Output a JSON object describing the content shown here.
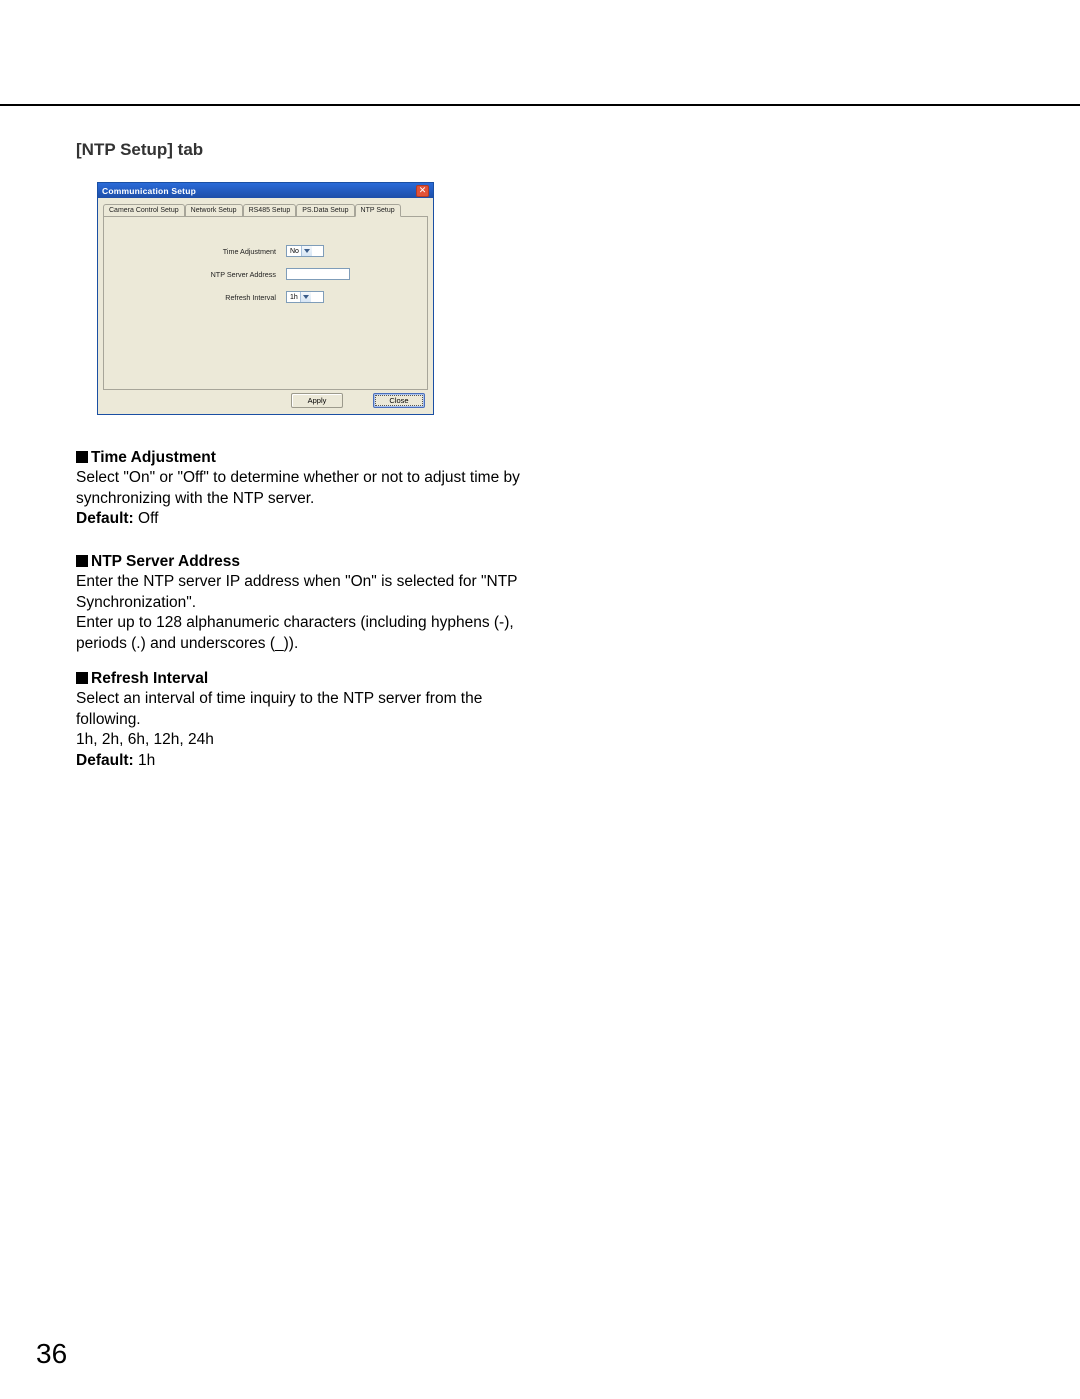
{
  "page": {
    "number": "36",
    "section_title": "[NTP Setup] tab"
  },
  "dialog": {
    "title": "Communication Setup",
    "close_glyph": "✕",
    "tabs": {
      "camera_control": "Camera Control Setup",
      "network": "Network Setup",
      "rs485": "RS485 Setup",
      "psdata": "PS.Data Setup",
      "ntp": "NTP Setup"
    },
    "fields": {
      "time_adjustment": {
        "label": "Time Adjustment",
        "value": "No"
      },
      "ntp_server_address": {
        "label": "NTP Server Address",
        "value": ""
      },
      "refresh_interval": {
        "label": "Refresh Interval",
        "value": "1h"
      }
    },
    "buttons": {
      "apply": "Apply",
      "close": "Close"
    }
  },
  "sections": {
    "time_adjustment": {
      "heading": "Time Adjustment",
      "body": "Select \"On\" or \"Off\" to determine whether or not to adjust time by synchronizing with the NTP server.",
      "default_label": "Default:",
      "default_value": " Off"
    },
    "ntp_server_address": {
      "heading": "NTP Server Address",
      "body1": "Enter the NTP server IP address when \"On\" is selected for \"NTP Synchronization\".",
      "body2": "Enter up to 128 alphanumeric characters (including hyphens (-), periods (.) and underscores (_))."
    },
    "refresh_interval": {
      "heading": "Refresh Interval",
      "body": "Select an interval of time inquiry to the NTP server from the following.",
      "options": "1h, 2h, 6h, 12h, 24h",
      "default_label": "Default:",
      "default_value": " 1h"
    }
  }
}
